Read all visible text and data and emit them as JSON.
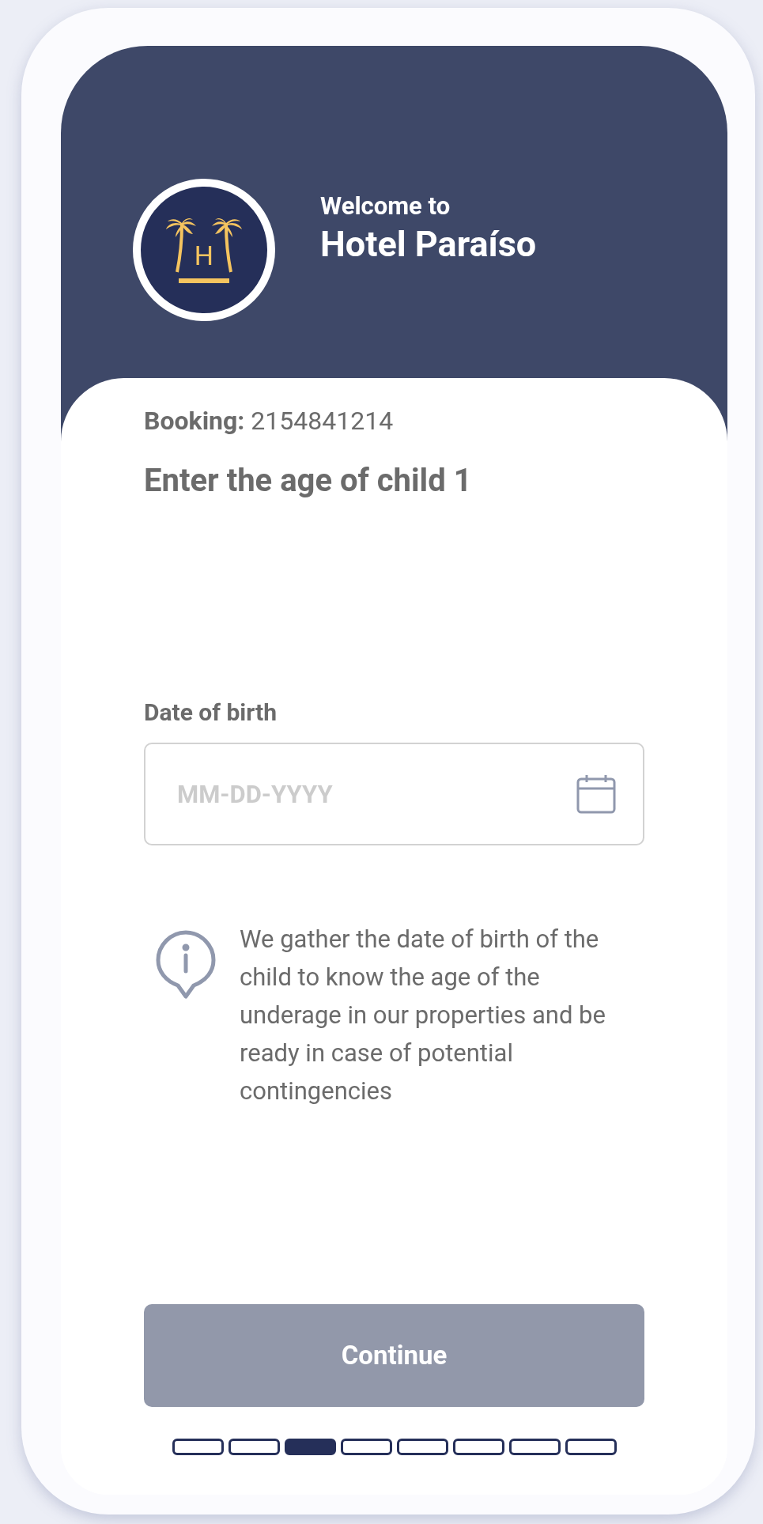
{
  "header": {
    "greeting": "Welcome to",
    "hotel_name": "Hotel Paraíso",
    "logo_letter": "H"
  },
  "booking": {
    "label": "Booking:",
    "number": "2154841214"
  },
  "heading": "Enter the age of child 1",
  "date_field": {
    "label": "Date of birth",
    "placeholder": "MM-DD-YYYY"
  },
  "info_note": "We gather the date of birth of the child to know the age of the underage in our properties and be ready in case of potential contingencies",
  "continue_button": {
    "label": "Continue",
    "disabled": true
  },
  "steps": [
    {
      "selected": false
    },
    {
      "selected": false
    },
    {
      "selected": true
    },
    {
      "selected": false
    },
    {
      "selected": false
    },
    {
      "selected": false
    },
    {
      "selected": false
    },
    {
      "selected": false
    }
  ]
}
